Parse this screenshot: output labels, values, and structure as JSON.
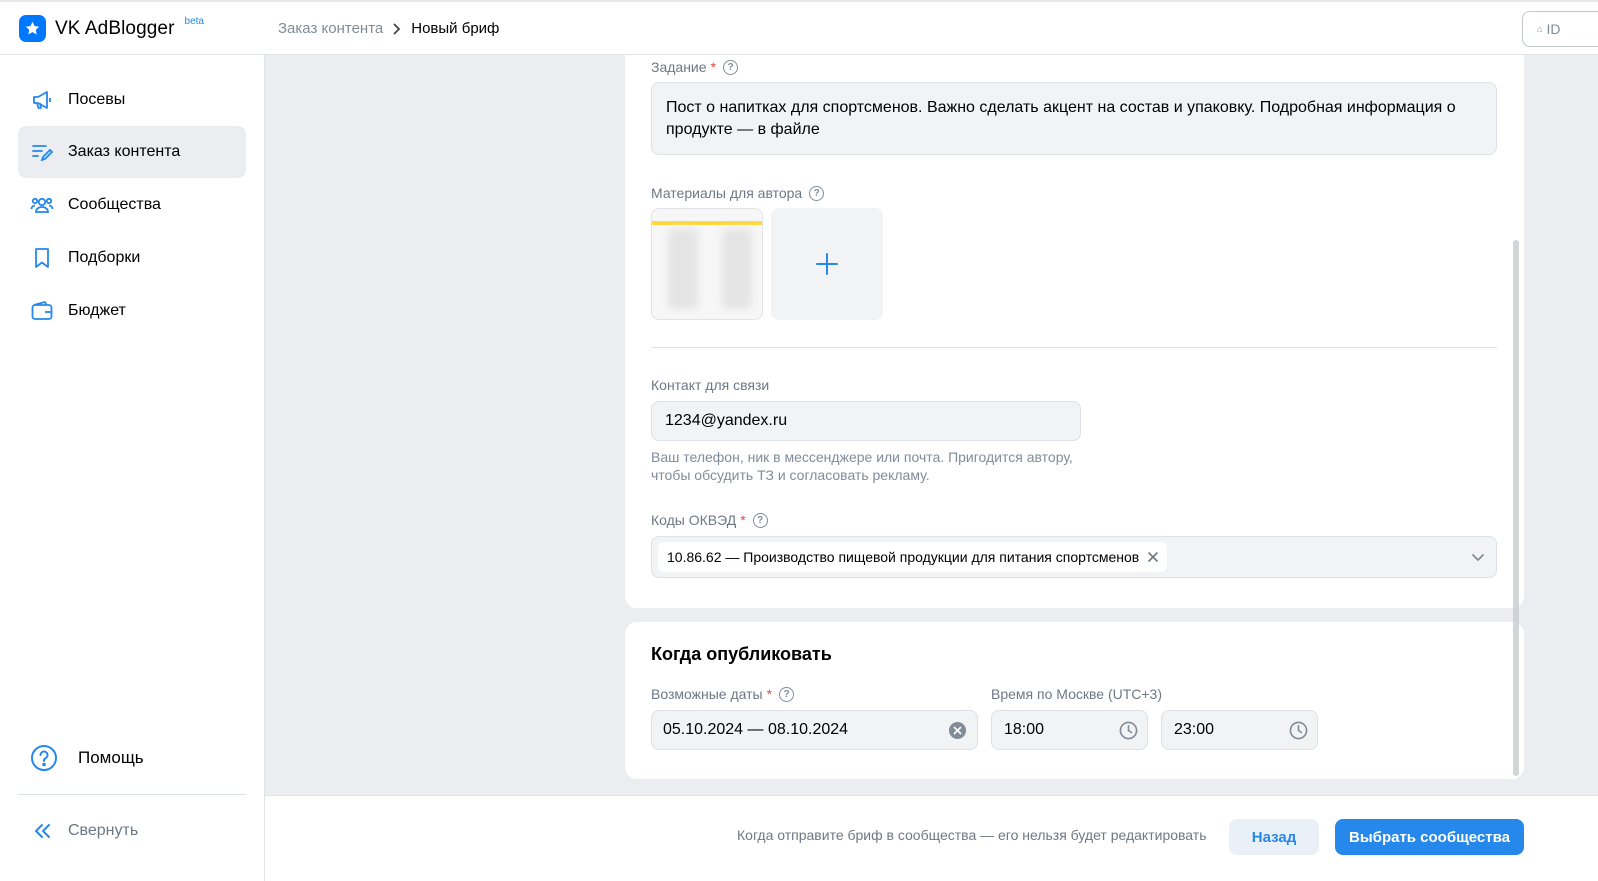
{
  "header": {
    "app_name": "VK AdBlogger",
    "beta": "beta",
    "breadcrumb": [
      "Заказ контента",
      "Новый бриф"
    ],
    "id_label": "ID"
  },
  "sidebar": {
    "items": [
      {
        "label": "Посевы",
        "icon": "megaphone-icon"
      },
      {
        "label": "Заказ контента",
        "icon": "edit-list-icon",
        "active": true
      },
      {
        "label": "Сообщества",
        "icon": "users-icon"
      },
      {
        "label": "Подборки",
        "icon": "bookmark-icon"
      },
      {
        "label": "Бюджет",
        "icon": "wallet-icon"
      }
    ],
    "help": "Помощь",
    "collapse": "Свернуть"
  },
  "brief": {
    "task_label": "Задание",
    "task_text": "Пост о напитках для спортсменов. Важно сделать акцент на состав и упаковку. Подробная информация о продукте — в файле",
    "materials_label": "Материалы для автора",
    "contact_label": "Контакт для связи",
    "contact_value": "1234@yandex.ru",
    "contact_hint": "Ваш телефон, ник в мессенджере или почта. Пригодится автору, чтобы обсудить ТЗ и согласовать рекламу.",
    "okved_label": "Коды ОКВЭД",
    "okved_chip": "10.86.62 — Производство пищевой продукции для питания спортсменов"
  },
  "publish": {
    "title": "Когда опубликовать",
    "dates_label": "Возможные даты",
    "dates_value": "05.10.2024 — 08.10.2024",
    "time_label": "Время по Москве (UTC+3)",
    "time_from": "18:00",
    "time_to": "23:00"
  },
  "footer": {
    "note": "Когда отправите бриф в сообщества — его нельзя будет редактировать",
    "back": "Назад",
    "primary": "Выбрать сообщества"
  },
  "colors": {
    "accent": "#2688eb",
    "brand": "#0077ff",
    "required": "#e64646"
  }
}
